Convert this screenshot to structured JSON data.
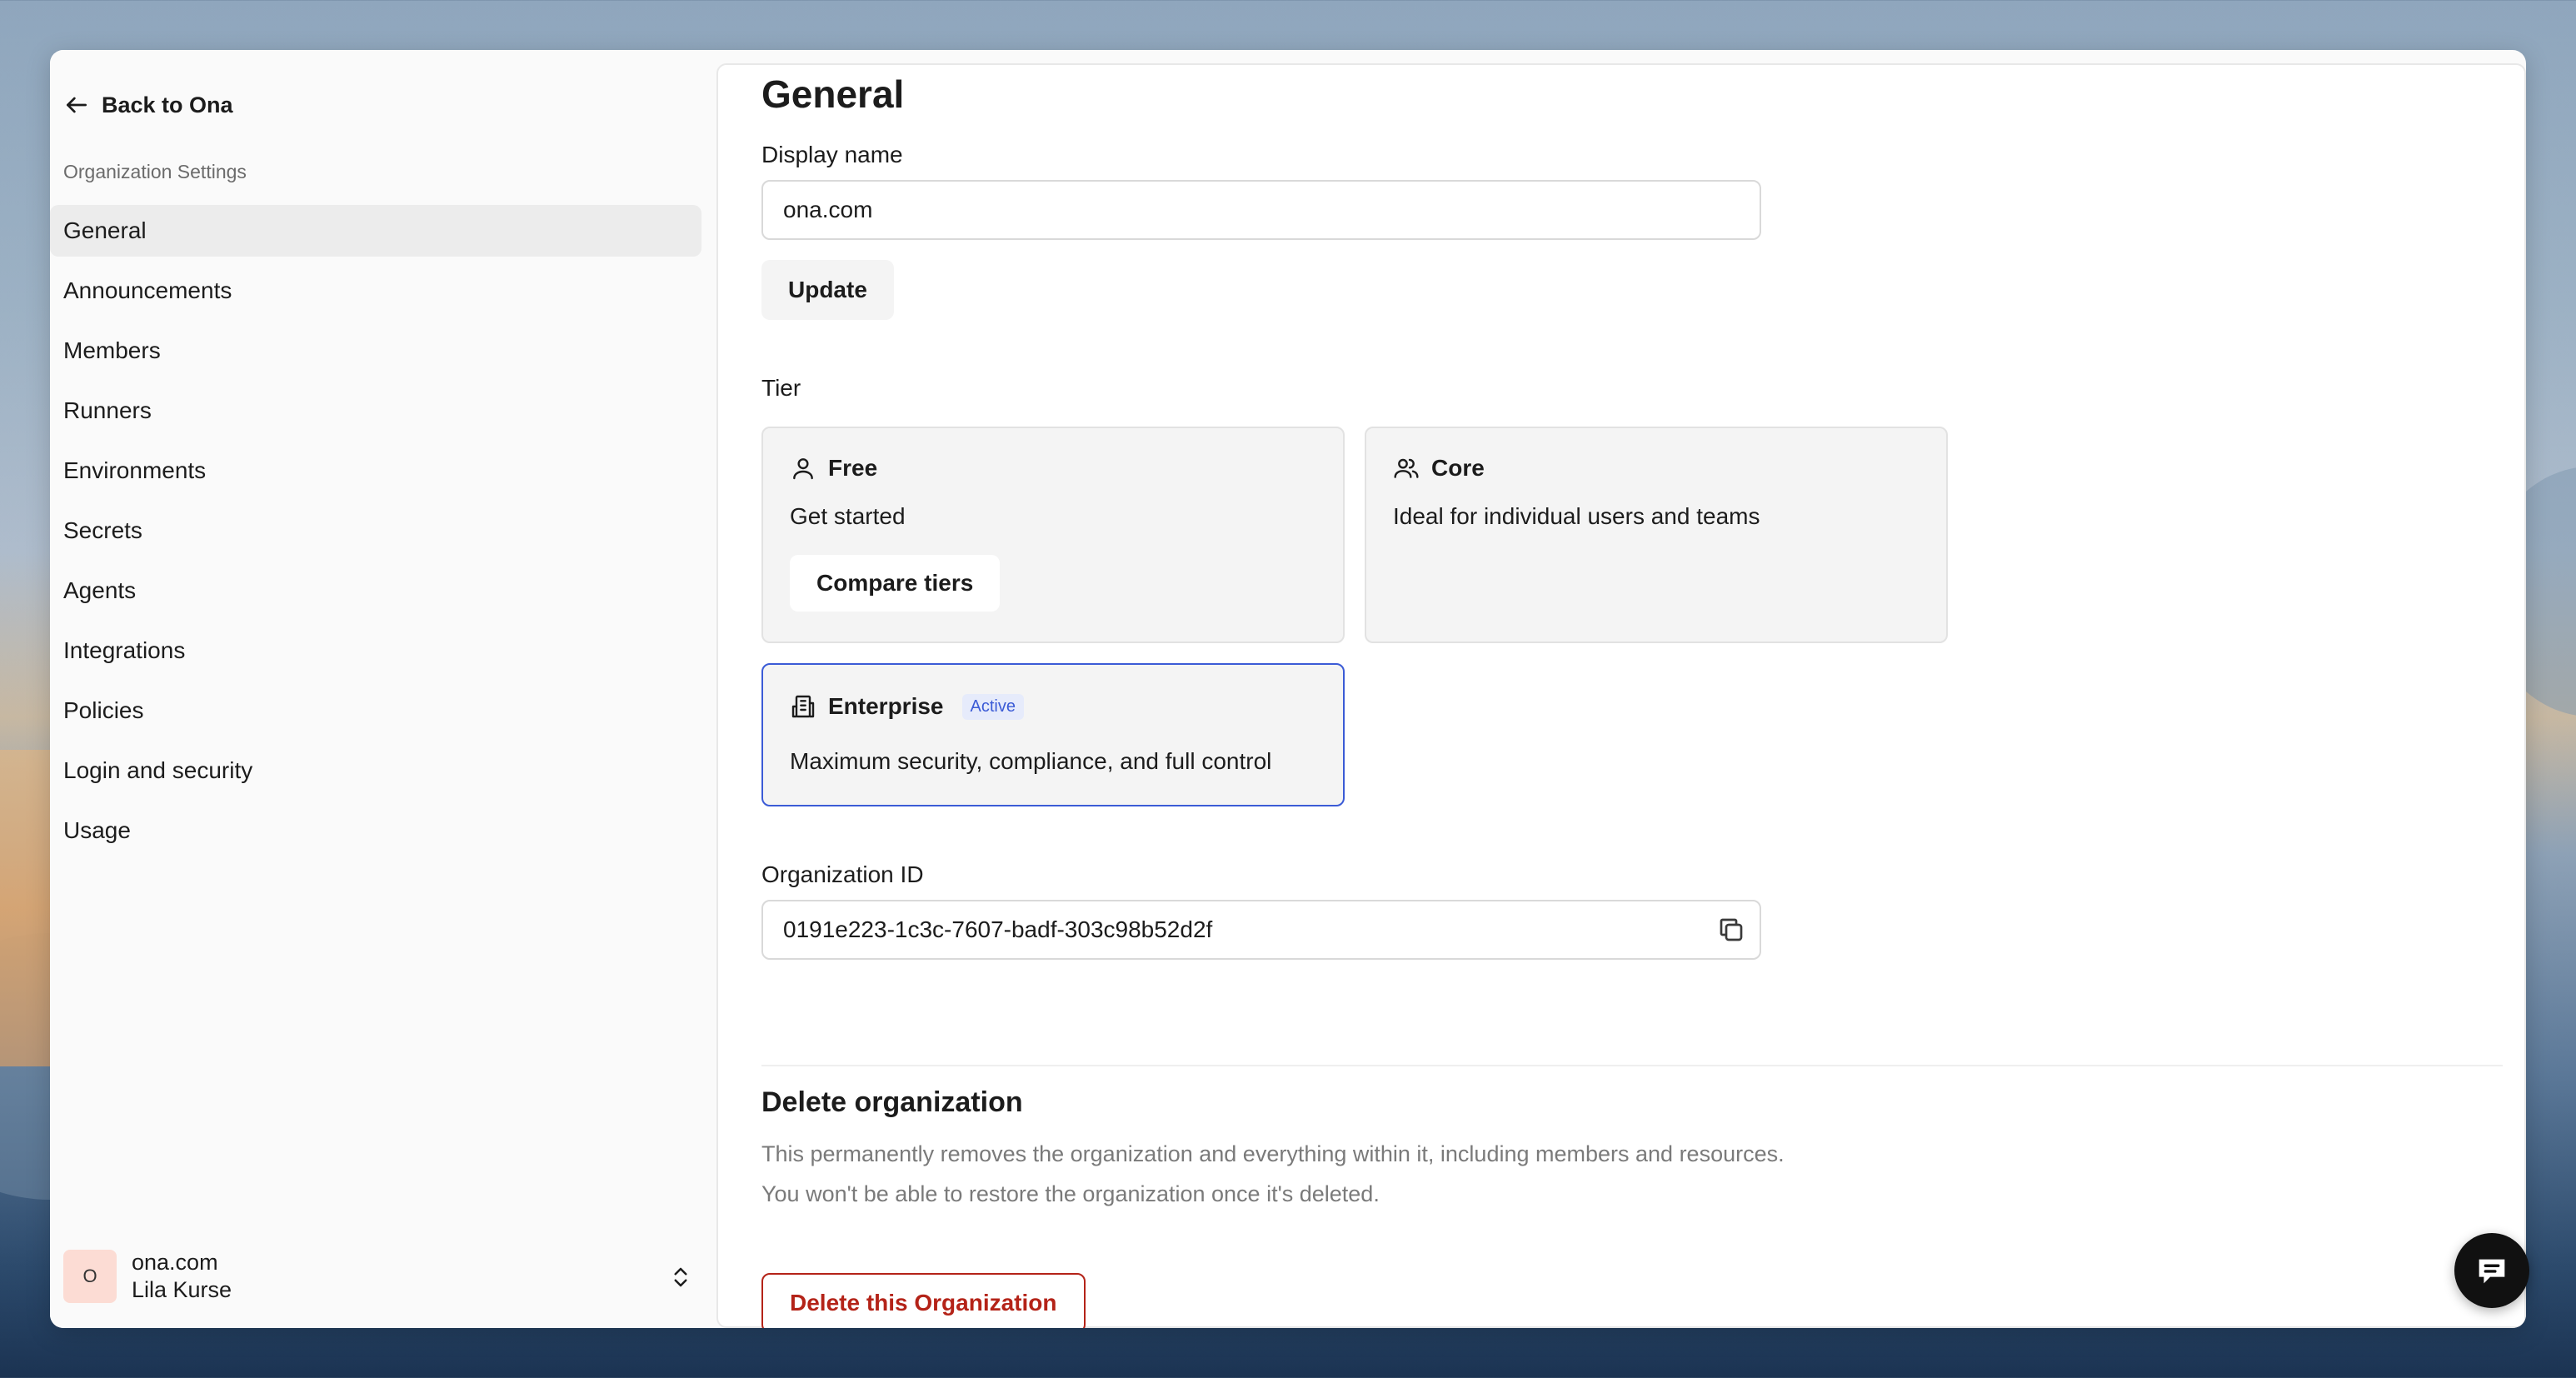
{
  "sidebar": {
    "back_label": "Back to Ona",
    "section_label": "Organization Settings",
    "items": [
      {
        "label": "General",
        "active": true
      },
      {
        "label": "Announcements"
      },
      {
        "label": "Members"
      },
      {
        "label": "Runners"
      },
      {
        "label": "Environments"
      },
      {
        "label": "Secrets"
      },
      {
        "label": "Agents"
      },
      {
        "label": "Integrations"
      },
      {
        "label": "Policies"
      },
      {
        "label": "Login and security"
      },
      {
        "label": "Usage"
      }
    ],
    "account": {
      "avatar_initial": "O",
      "org_name": "ona.com",
      "user_name": "Lila Kurse"
    }
  },
  "main": {
    "title": "General",
    "display_name": {
      "label": "Display name",
      "value": "ona.com"
    },
    "update_label": "Update",
    "tier": {
      "label": "Tier",
      "cards": [
        {
          "name": "Free",
          "description": "Get started",
          "button": "Compare tiers",
          "icon": "user-icon"
        },
        {
          "name": "Core",
          "description": "Ideal for individual users and teams",
          "icon": "users-icon"
        },
        {
          "name": "Enterprise",
          "badge": "Active",
          "description": "Maximum security, compliance, and full control",
          "icon": "building-icon",
          "active": true
        }
      ]
    },
    "org_id": {
      "label": "Organization ID",
      "value": "0191e223-1c3c-7607-badf-303c98b52d2f"
    },
    "danger": {
      "title": "Delete organization",
      "line1": "This permanently removes the organization and everything within it, including members and resources.",
      "line2": "You won't be able to restore the organization once it's deleted.",
      "button": "Delete this Organization"
    }
  },
  "colors": {
    "accent": "#3b5bd6",
    "danger": "#b42318",
    "active_nav": "#ececec"
  }
}
